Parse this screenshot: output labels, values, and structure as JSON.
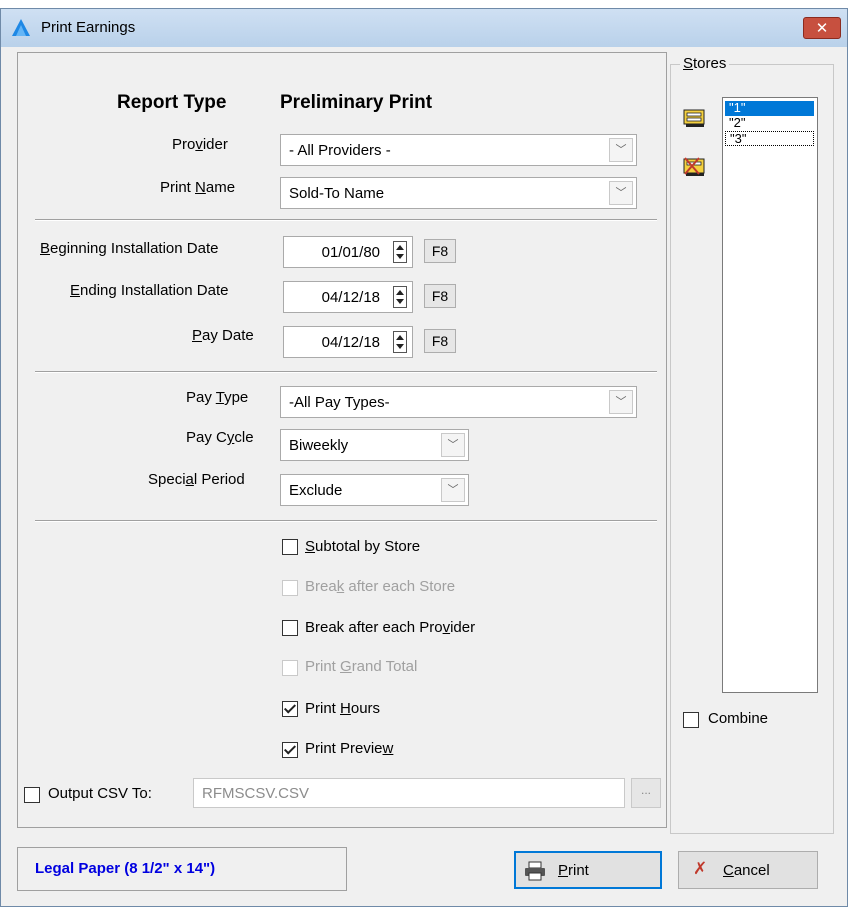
{
  "window": {
    "title": "Print Earnings",
    "close_label": "x"
  },
  "report": {
    "type_label": "Report Type",
    "type_value": "Preliminary Print"
  },
  "provider": {
    "label": "Provider",
    "value": "- All Providers -"
  },
  "print_name": {
    "label": "Print Name",
    "value": "Sold-To Name"
  },
  "dates": {
    "begin": {
      "label": "Beginning Installation Date",
      "value": "01/01/80",
      "key": "F8"
    },
    "end": {
      "label": "Ending Installation Date",
      "value": "04/12/18",
      "key": "F8"
    },
    "pay": {
      "label": "Pay Date",
      "value": "04/12/18",
      "key": "F8"
    }
  },
  "pay_type": {
    "label": "Pay Type",
    "value": "-All Pay Types-"
  },
  "pay_cycle": {
    "label": "Pay Cycle",
    "value": "Biweekly"
  },
  "special_period": {
    "label": "Special Period",
    "value": "Exclude"
  },
  "options": {
    "subtotal_by_store": {
      "label": "Subtotal by Store",
      "checked": false,
      "enabled": true
    },
    "break_each_store": {
      "label": "Break after each Store",
      "checked": false,
      "enabled": false
    },
    "break_each_provider": {
      "label": "Break after each Provider",
      "checked": false,
      "enabled": true
    },
    "print_grand_total": {
      "label": "Print Grand Total",
      "checked": false,
      "enabled": false
    },
    "print_hours": {
      "label": "Print Hours",
      "checked": true,
      "enabled": true
    },
    "print_preview": {
      "label": "Print Preview",
      "checked": true,
      "enabled": true
    }
  },
  "csv": {
    "label": "Output CSV To:",
    "value": "RFMSCSV.CSV",
    "checked": false,
    "browse_label": "..."
  },
  "stores": {
    "label": "Stores",
    "items": [
      "\"1\"",
      "\"2\"",
      "\"3\""
    ],
    "selected": "\"1\"",
    "combine_label": "Combine"
  },
  "paper": {
    "label": "Legal Paper (8 1/2\" x 14\")"
  },
  "buttons": {
    "print": "Print",
    "cancel": "Cancel"
  },
  "colors": {
    "title_bar": "#c4d9ef",
    "selection": "#0078d7",
    "paper_text": "#0000e0",
    "close": "#c7503f"
  },
  "icons": [
    "app-logo-icon",
    "close-icon",
    "spin-icon",
    "check-icon",
    "printer-icon",
    "cancel-x-icon",
    "select-all-stores-icon",
    "deselect-stores-icon"
  ]
}
